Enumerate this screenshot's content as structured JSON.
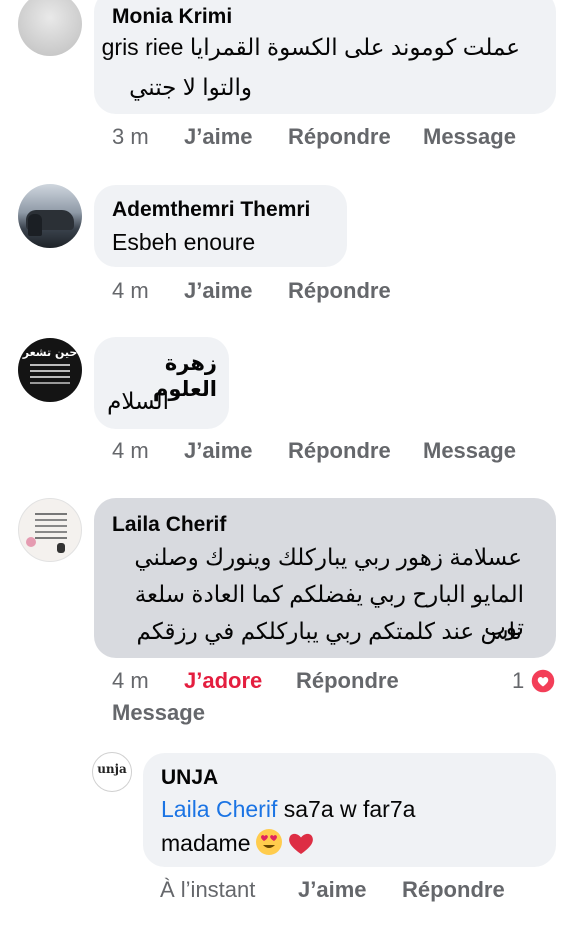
{
  "comments": [
    {
      "author": "Monia Krimi",
      "text_line1": "عملت كوموند على الكسوة القمرايا gris riee",
      "text_line2": "والتوا لا جتني",
      "time": "3 m",
      "like": "J’aime",
      "reply": "Répondre",
      "message": "Message"
    },
    {
      "author": "Ademthemri Themri",
      "text_line1": "Esbeh enoure",
      "time": "4 m",
      "like": "J’aime",
      "reply": "Répondre"
    },
    {
      "author": "زهرة العلوم",
      "text_line1": "السلام",
      "time": "4 m",
      "like": "J’aime",
      "reply": "Répondre",
      "message": "Message",
      "avatar_text": "حين تشعر"
    },
    {
      "author": "Laila Cherif",
      "text_line1": "عسلامة زهور ربي يباركلك وينورك وصلني",
      "text_line2": "المايو البارح ربي يفضلكم كما العادة سلعة توب",
      "text_line3": "ناس عند كلمتكم ربي يباركلكم في رزقكم",
      "time": "4 m",
      "reaction": "J’adore",
      "reply": "Répondre",
      "reaction_count": "1",
      "message": "Message"
    }
  ],
  "reply": {
    "author": "UNJA",
    "avatar_text": "unja",
    "mention": "Laila Cherif",
    "text_after_mention": " sa7a w far7a",
    "text_line2": "madame",
    "time": "À l’instant",
    "like": "J’aime",
    "reply": "Répondre"
  },
  "colors": {
    "bubble_grey": "#f0f2f5",
    "bubble_highlight": "#d8dadf",
    "action_text": "#65676b",
    "love_red": "#e41e3f",
    "mention_blue": "#1b74e4"
  }
}
